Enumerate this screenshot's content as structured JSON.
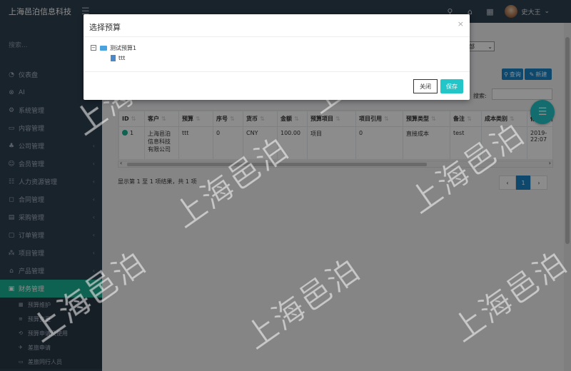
{
  "app": {
    "title": "上海邑泊信息科技",
    "menu_icon": "hamburger-icon"
  },
  "topbar": {
    "user_name": "史大王",
    "icons": [
      "search-icon",
      "home-icon",
      "calendar-icon"
    ]
  },
  "sidebar": {
    "search_placeholder": "搜索...",
    "items": [
      {
        "icon": "dashboard-icon",
        "label": "仪表盘",
        "glyph": "◔"
      },
      {
        "icon": "ai-icon",
        "label": "AI",
        "glyph": "⊗"
      },
      {
        "icon": "settings-icon",
        "label": "系统管理",
        "glyph": "⚙"
      },
      {
        "icon": "content-icon",
        "label": "内容管理",
        "glyph": "▭"
      },
      {
        "icon": "company-icon",
        "label": "公司管理",
        "glyph": "♣"
      },
      {
        "icon": "member-icon",
        "label": "会员管理",
        "glyph": "☺"
      },
      {
        "icon": "hr-icon",
        "label": "人力资源管理",
        "glyph": "☷"
      },
      {
        "icon": "contract-icon",
        "label": "合同管理",
        "glyph": "◻"
      },
      {
        "icon": "purchase-icon",
        "label": "采购管理",
        "glyph": "▤"
      },
      {
        "icon": "order-icon",
        "label": "订单管理",
        "glyph": "▢"
      },
      {
        "icon": "project-icon",
        "label": "项目管理",
        "glyph": "⁂"
      },
      {
        "icon": "product-icon",
        "label": "产品管理",
        "glyph": "⌂"
      },
      {
        "icon": "finance-icon",
        "label": "财务管理",
        "glyph": "▣"
      }
    ],
    "sub_items": [
      {
        "icon": "budget-icon",
        "label": "预算维护",
        "glyph": "▦"
      },
      {
        "icon": "budget-change-icon",
        "label": "预算变更",
        "glyph": "≡"
      },
      {
        "icon": "budget-apply-icon",
        "label": "预算申请及使用",
        "glyph": "⟲"
      },
      {
        "icon": "expense-icon",
        "label": "差旅申请",
        "glyph": "✈"
      },
      {
        "icon": "travel-people-icon",
        "label": "差旅同行人员",
        "glyph": "▭"
      }
    ]
  },
  "main": {
    "dept_select_value": "部",
    "query_label": "查询",
    "new_label": "新建",
    "search_label": "搜索:",
    "table": {
      "columns": [
        "ID",
        "客户",
        "预算",
        "序号",
        "货币",
        "金额",
        "预算项目",
        "项目引用",
        "预算类型",
        "备注",
        "成本类别",
        "修改时间"
      ],
      "rows": [
        [
          "1",
          "上海邑泊信息科技有限公司",
          "ttt",
          "0",
          "CNY",
          "100.00",
          "项目",
          "0",
          "直接成本",
          "test",
          "",
          "2019-22:07"
        ]
      ]
    },
    "footer_info": "显示第 1 至 1 项结果，共 1 项",
    "pager": {
      "prev": "‹",
      "current": "1",
      "next": "›"
    }
  },
  "modal": {
    "title": "选择预算",
    "close_glyph": "×",
    "tree": {
      "root_label": "测试预算1",
      "child_label": "ttt"
    },
    "close_button": "关闭",
    "save_button": "保存"
  },
  "watermark": "上海邑泊",
  "colors": {
    "sidebar_bg": "#2f4050",
    "accent_green": "#1ab394",
    "primary_blue": "#1c84c6",
    "teal": "#23c6c8"
  }
}
